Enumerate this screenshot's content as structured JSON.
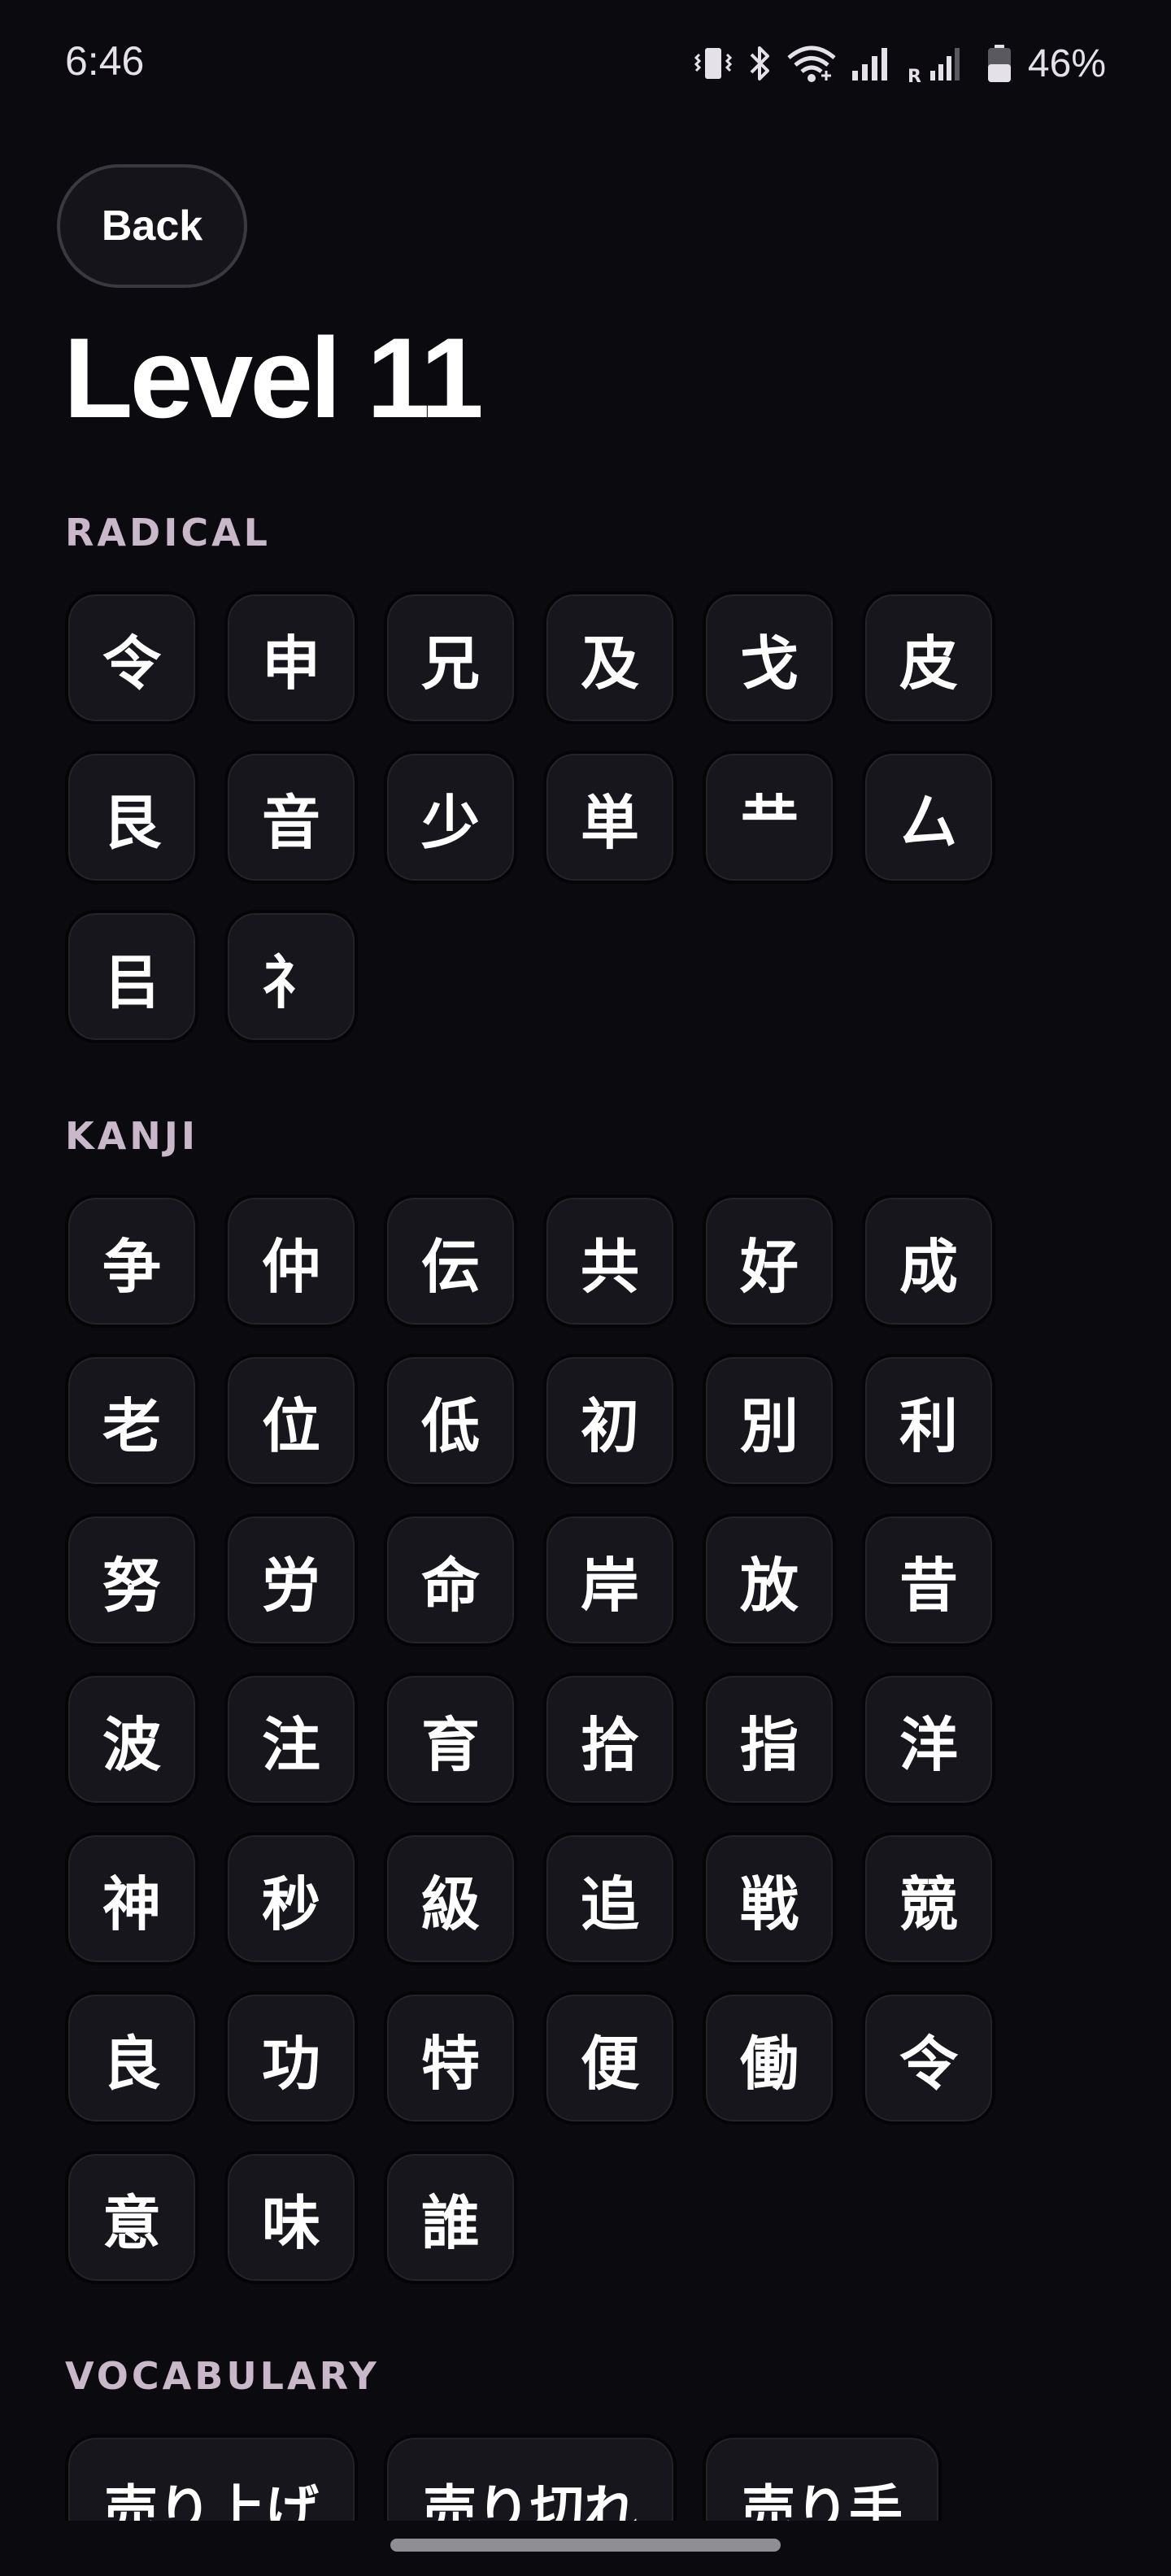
{
  "status_bar": {
    "time": "6:46",
    "battery": "46%",
    "icons": [
      "vibrate-icon",
      "bluetooth-icon",
      "wifi-icon",
      "signal-icon",
      "roaming-signal-icon",
      "battery-icon"
    ]
  },
  "back_label": "Back",
  "title": "Level 11",
  "sections": {
    "radical": {
      "label": "RADICAL",
      "items": [
        "令",
        "申",
        "兄",
        "及",
        "戈",
        "皮",
        "艮",
        "音",
        "少",
        "単",
        "龷",
        "厶",
        "㠯",
        "⺭"
      ]
    },
    "kanji": {
      "label": "KANJI",
      "items": [
        "争",
        "仲",
        "伝",
        "共",
        "好",
        "成",
        "老",
        "位",
        "低",
        "初",
        "別",
        "利",
        "努",
        "労",
        "命",
        "岸",
        "放",
        "昔",
        "波",
        "注",
        "育",
        "拾",
        "指",
        "洋",
        "神",
        "秒",
        "級",
        "追",
        "戦",
        "競",
        "良",
        "功",
        "特",
        "便",
        "働",
        "令",
        "意",
        "味",
        "誰"
      ]
    },
    "vocabulary": {
      "label": "VOCABULARY",
      "items": [
        "売り上げ",
        "売り切れ",
        "売り手"
      ]
    }
  },
  "colors": {
    "background": "#0b0a0f",
    "tile": "#17161c",
    "section_label": "#c9b8c9"
  }
}
